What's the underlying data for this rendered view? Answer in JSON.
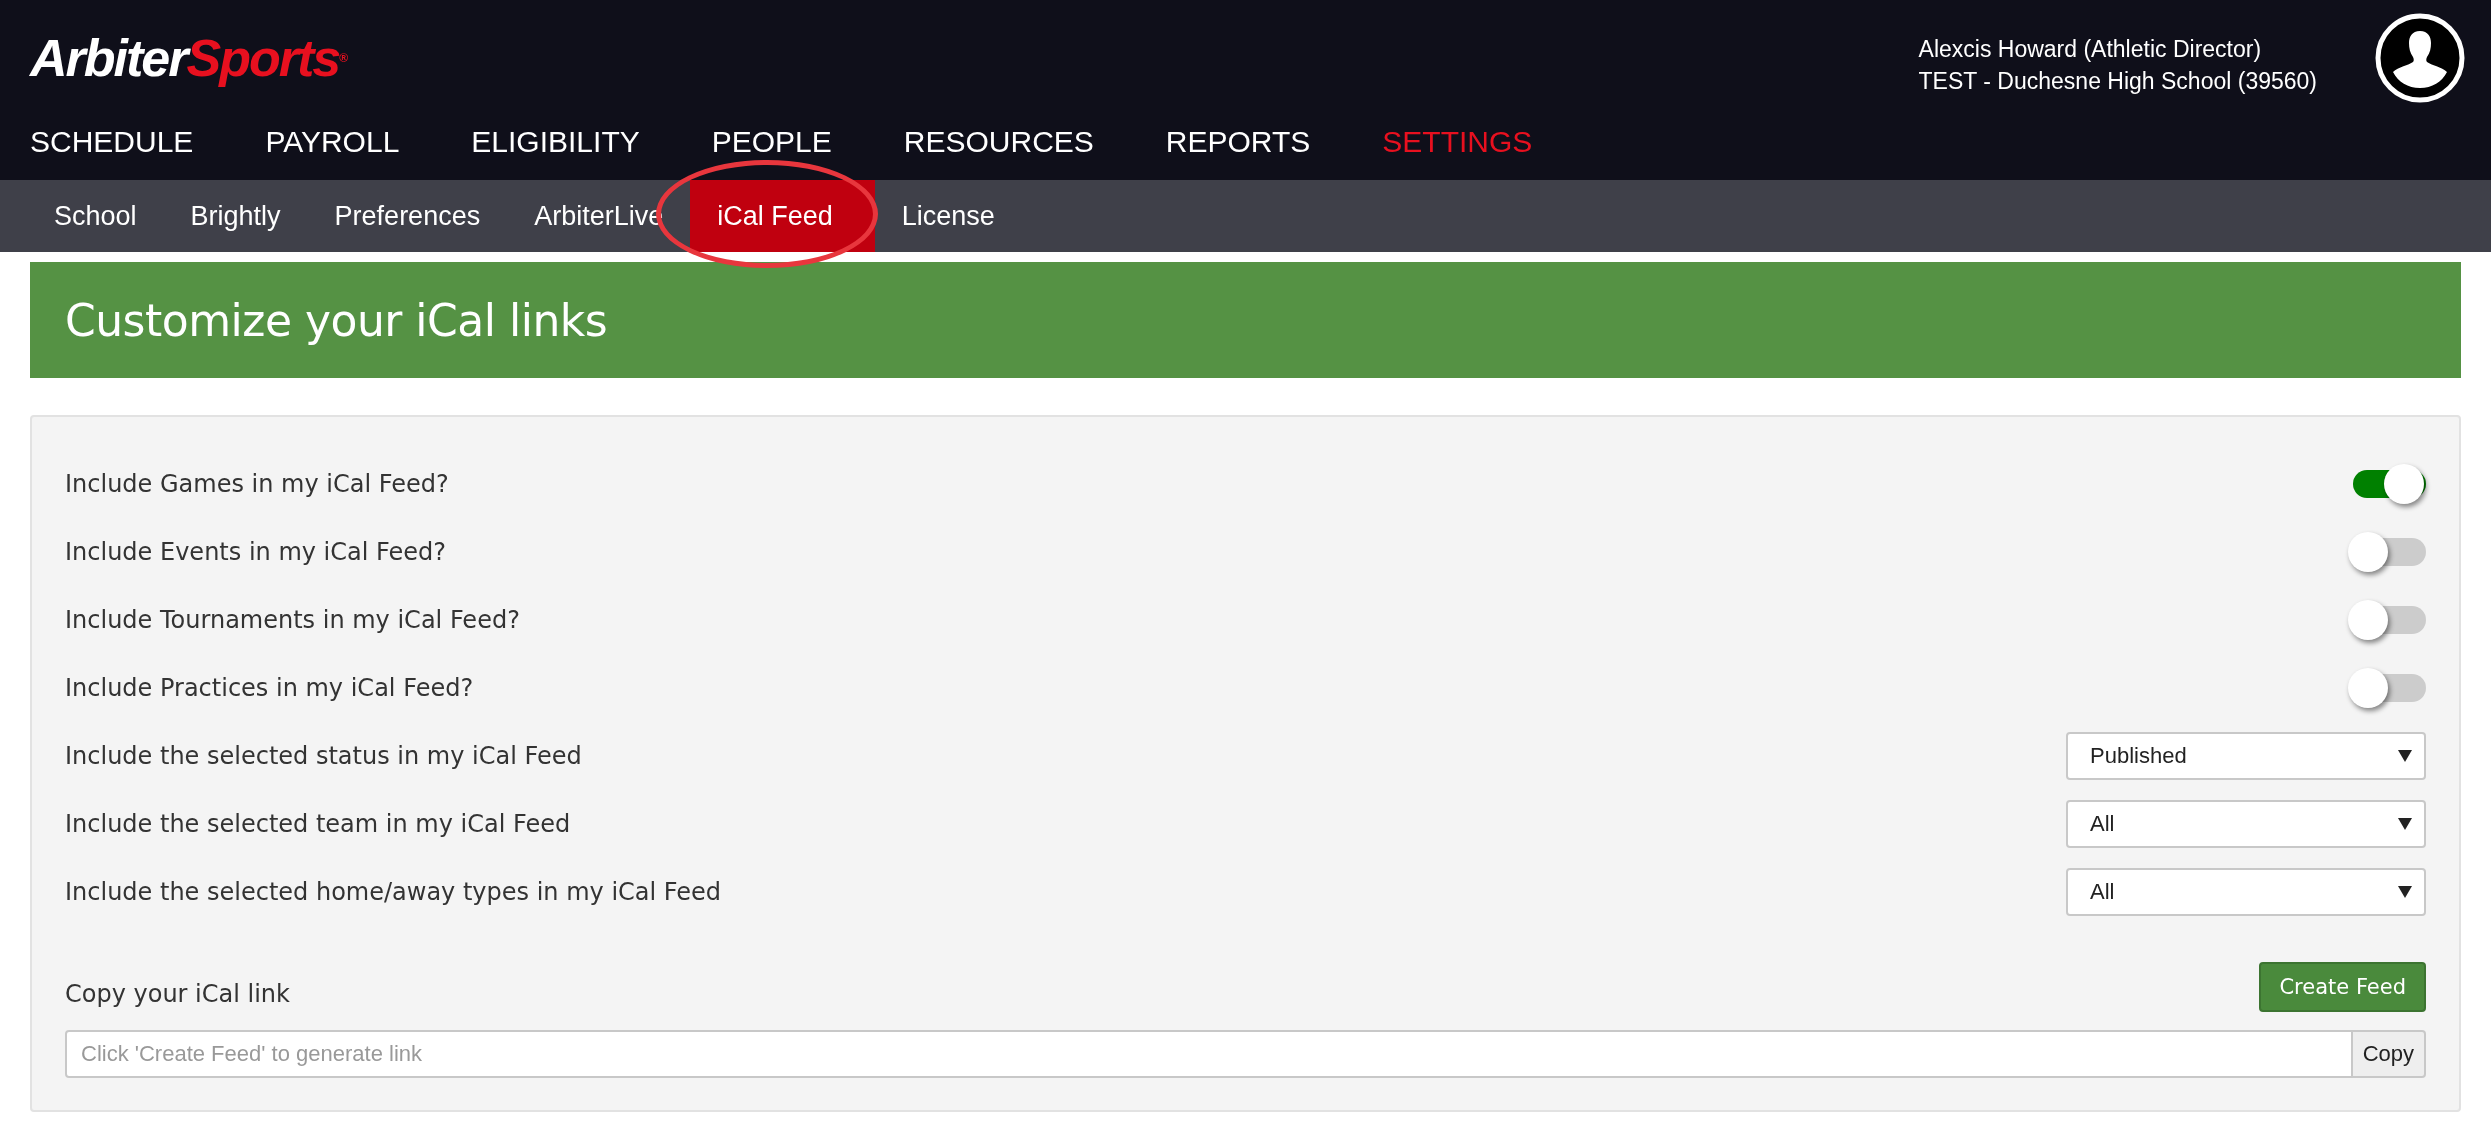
{
  "header": {
    "logo": {
      "part_1": "Arbiter",
      "part_2": "Sports",
      "mark": "®"
    },
    "user": {
      "name": "Alexcis Howard (Athletic Director)",
      "organization": "TEST - Duchesne High School (39560)"
    }
  },
  "main_nav": [
    {
      "label": "SCHEDULE",
      "selected": false
    },
    {
      "label": "PAYROLL",
      "selected": false
    },
    {
      "label": "ELIGIBILITY",
      "selected": false
    },
    {
      "label": "PEOPLE",
      "selected": false
    },
    {
      "label": "RESOURCES",
      "selected": false
    },
    {
      "label": "REPORTS",
      "selected": false
    },
    {
      "label": "SETTINGS",
      "selected": true
    }
  ],
  "sub_nav": [
    {
      "label": "School",
      "selected": false,
      "circled": false
    },
    {
      "label": "Brightly",
      "selected": false,
      "circled": false
    },
    {
      "label": "Preferences",
      "selected": false,
      "circled": false
    },
    {
      "label": "ArbiterLive",
      "selected": false,
      "circled": false
    },
    {
      "label": "iCal Feed",
      "selected": true,
      "circled": true
    },
    {
      "label": "License",
      "selected": false,
      "circled": false
    }
  ],
  "page_title": "Customize your iCal links",
  "settings": [
    {
      "kind": "toggle",
      "label": "Include Games in my iCal Feed?",
      "on": true
    },
    {
      "kind": "toggle",
      "label": "Include Events in my iCal Feed?",
      "on": false
    },
    {
      "kind": "toggle",
      "label": "Include Tournaments in my iCal Feed?",
      "on": false
    },
    {
      "kind": "toggle",
      "label": "Include Practices in my iCal Feed?",
      "on": false
    },
    {
      "kind": "select",
      "label": "Include the selected status in my iCal Feed",
      "value": "Published"
    },
    {
      "kind": "select",
      "label": "Include the selected team in my iCal Feed",
      "value": "All"
    },
    {
      "kind": "select",
      "label": "Include the selected home/away types in my iCal Feed",
      "value": "All"
    }
  ],
  "link": {
    "label": "Copy your iCal link",
    "create_button": "Create Feed",
    "field": {
      "placeholder": "Click 'Create Feed' to generate link"
    },
    "copy_button": "Copy"
  }
}
